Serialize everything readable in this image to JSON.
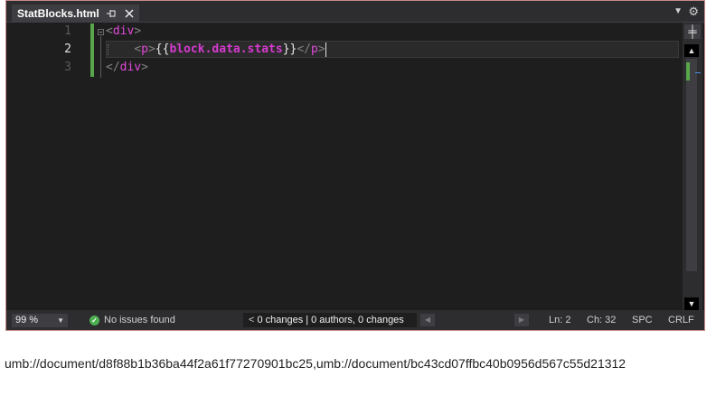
{
  "tab": {
    "title": "StatBlocks.html",
    "pin_icon": "pin-icon",
    "close_icon": "close-icon"
  },
  "tabstrip": {
    "dropdown_icon": "chevron-down-icon",
    "settings_icon": "gear-icon"
  },
  "editor": {
    "line_numbers": [
      "1",
      "2",
      "3"
    ],
    "active_line": "2",
    "lines": [
      {
        "open": "<",
        "tag": "div",
        "close": ">"
      },
      {
        "indent": "    ",
        "open1": "<",
        "tag1": "p",
        "close1": ">",
        "brace_open": "{{",
        "expr": "block.data.stats",
        "brace_close": "}}",
        "open2": "</",
        "tag2": "p",
        "close2": ">"
      },
      {
        "open": "</",
        "tag": "div",
        "close": ">"
      }
    ]
  },
  "scrollbar": {
    "split_icon": "split-editor-icon",
    "up_icon": "scroll-up-icon",
    "down_icon": "scroll-down-icon"
  },
  "status": {
    "zoom": "99 %",
    "issues": "No issues found",
    "changes": "0 changes",
    "separator": "|",
    "authors": "0 authors, 0 changes",
    "line": "Ln: 2",
    "char": "Ch: 32",
    "indent": "SPC",
    "eol": "CRLF"
  },
  "colors": {
    "tag": "#e04ad7",
    "punctuation": "#808080",
    "change_marker": "#57a64a",
    "editor_bg": "#1e1e1e",
    "chrome_bg": "#2d2d30"
  },
  "footer": {
    "text": "umb://document/d8f88b1b36ba44f2a61f77270901bc25,umb://document/bc43cd07ffbc40b0956d567c55d21312"
  }
}
